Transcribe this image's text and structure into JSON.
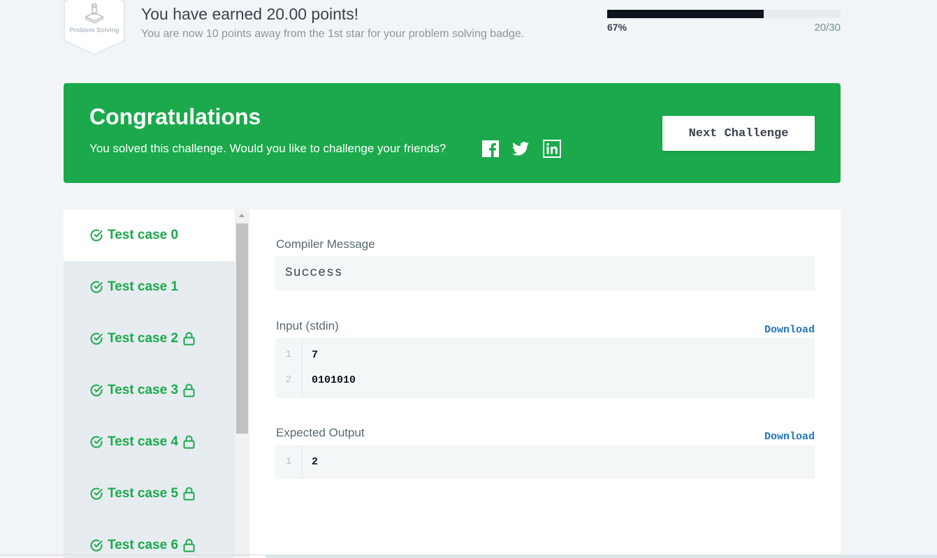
{
  "badge": {
    "label": "Problem Solving",
    "icon": "problem-solving-icon"
  },
  "earned": {
    "title": "You have earned 20.00 points!",
    "subtitle": "You are now 10 points away from the 1st star for your problem solving badge."
  },
  "progress": {
    "percent_label": "67%",
    "count_label": "20/30",
    "fraction": 0.67
  },
  "banner": {
    "title": "Congratulations",
    "text": "You solved this challenge. Would you like to challenge your friends?",
    "share_icons": [
      "facebook-icon",
      "twitter-icon",
      "linkedin-icon"
    ],
    "next_button": "Next Challenge",
    "color": "#1ba94c"
  },
  "test_cases": [
    {
      "label": "Test case 0",
      "locked": false,
      "active": true
    },
    {
      "label": "Test case 1",
      "locked": false,
      "active": false
    },
    {
      "label": "Test case 2",
      "locked": true,
      "active": false
    },
    {
      "label": "Test case 3",
      "locked": true,
      "active": false
    },
    {
      "label": "Test case 4",
      "locked": true,
      "active": false
    },
    {
      "label": "Test case 5",
      "locked": true,
      "active": false
    },
    {
      "label": "Test case 6",
      "locked": true,
      "active": false
    }
  ],
  "detail": {
    "compiler_label": "Compiler Message",
    "compiler_message": "Success",
    "input_label": "Input (stdin)",
    "input_download": "Download",
    "input_lines": [
      {
        "num": "1",
        "text": "7"
      },
      {
        "num": "2",
        "text": "0101010"
      }
    ],
    "output_label": "Expected Output",
    "output_download": "Download",
    "output_lines": [
      {
        "num": "1",
        "text": "2"
      }
    ]
  }
}
